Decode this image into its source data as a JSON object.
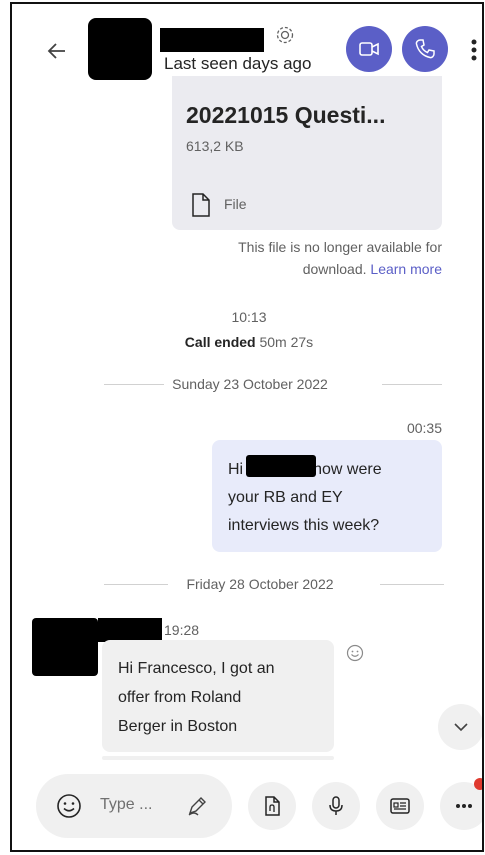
{
  "header": {
    "status": "Last seen days ago",
    "back_icon": "arrow-left-icon",
    "settings_icon": "gear-icon",
    "video_icon": "video-camera-icon",
    "call_icon": "phone-icon",
    "more_icon": "more-vertical-icon",
    "accent": "#5b5fc7"
  },
  "file_message": {
    "name": "20221015 Questi...",
    "size": "613,2 KB",
    "type_label": "File",
    "unavailable_text_1": "This file is no longer available for",
    "unavailable_text_2": "download.",
    "learn_more": "Learn more"
  },
  "call_event": {
    "time": "10:13",
    "title": "Call ended",
    "duration": "50m 27s"
  },
  "date_separators": [
    "Sunday 23 October 2022",
    "Friday 28 October 2022"
  ],
  "sent_message": {
    "time": "00:35",
    "greeting": "Hi",
    "line1_rest": "how were",
    "line2": "your RB and EY",
    "line3": "interviews this week?"
  },
  "received_message": {
    "time": "19:28",
    "line1": "Hi Francesco, I got an",
    "line2": "offer from Roland",
    "line3": "Berger in Boston"
  },
  "composer": {
    "placeholder": "Type ...",
    "emoji_icon": "emoji-icon",
    "format_icon": "format-pen-icon",
    "attach_icon": "attach-file-icon",
    "mic_icon": "microphone-icon",
    "contact_icon": "contact-card-icon",
    "more_icon": "more-horizontal-icon"
  },
  "scroll_down_icon": "chevron-down-icon"
}
